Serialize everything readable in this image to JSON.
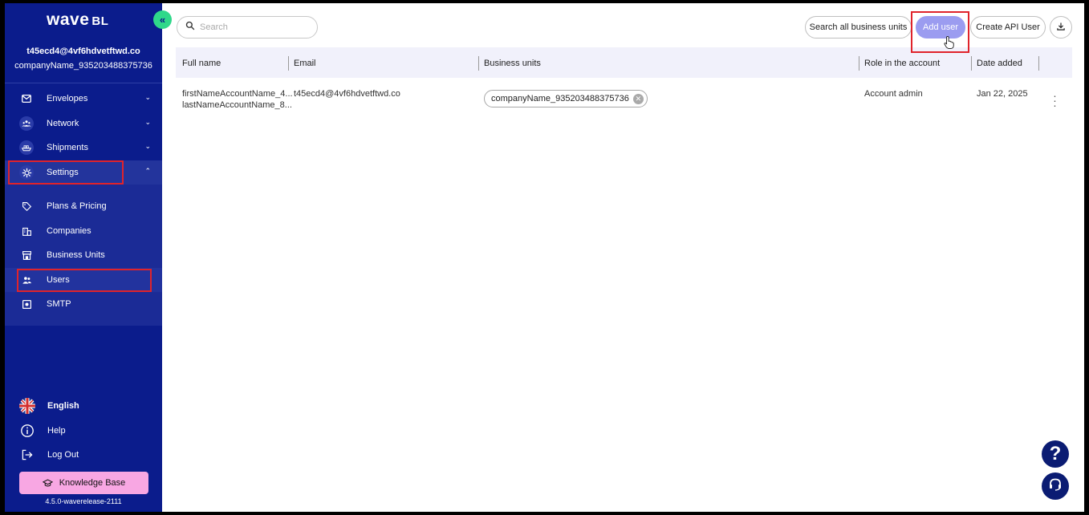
{
  "sidebar": {
    "logo_main": "wave",
    "logo_suffix": "BL",
    "collapse_icon": "double-chevron-left-icon",
    "account_email": "t45ecd4@4vf6hdvetftwd.co",
    "account_company": "companyName_935203488375736",
    "nav": [
      {
        "label": "Envelopes",
        "icon": "envelope-icon"
      },
      {
        "label": "Network",
        "icon": "network-icon"
      },
      {
        "label": "Shipments",
        "icon": "ship-icon"
      },
      {
        "label": "Settings",
        "icon": "gear-icon",
        "expanded": true
      }
    ],
    "submenu": [
      {
        "label": "Plans & Pricing",
        "icon": "tag-icon"
      },
      {
        "label": "Companies",
        "icon": "building-icon"
      },
      {
        "label": "Business Units",
        "icon": "store-icon"
      },
      {
        "label": "Users",
        "icon": "users-icon",
        "active": true
      },
      {
        "label": "SMTP",
        "icon": "smtp-icon"
      }
    ],
    "language": "English",
    "help": "Help",
    "logout": "Log Out",
    "knowledge_base": "Knowledge Base",
    "version": "4.5.0-waverelease-2111"
  },
  "toolbar": {
    "search_placeholder": "Search",
    "search_all_bu": "Search all business units",
    "add_user": "Add user",
    "create_api_user": "Create API User"
  },
  "table": {
    "headers": [
      "Full name",
      "Email",
      "Business units",
      "Role in the account",
      "Date added"
    ],
    "rows": [
      {
        "first_name": "firstNameAccountName_4...",
        "last_name": "lastNameAccountName_8...",
        "email": "t45ecd4@4vf6hdvetftwd.co",
        "business_unit": "companyName_935203488375736",
        "role": "Account admin",
        "date_added": "Jan 22, 2025"
      }
    ]
  },
  "fab": {
    "help_label": "?"
  },
  "colors": {
    "sidebar_bg": "#0b1c8c",
    "accent_green": "#2fd88a",
    "add_user_bg": "#9b9cf0",
    "kb_pink": "#f8a7e3",
    "highlight_red": "#e0232b"
  }
}
